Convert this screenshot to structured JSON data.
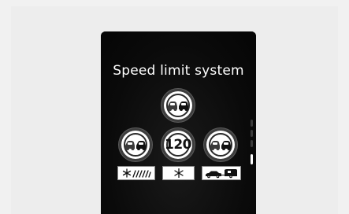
{
  "screen": {
    "title": "Speed limit system"
  },
  "signs": {
    "top": {
      "icon": "no-overtaking-icon"
    },
    "left": {
      "icon": "no-overtaking-icon"
    },
    "center": {
      "speed": "120"
    },
    "right": {
      "icon": "no-overtaking-icon"
    }
  },
  "conditions": {
    "left": {
      "icon": "snow-rain-icon"
    },
    "center": {
      "icon": "snowflake-icon"
    },
    "right": {
      "icon": "car-trailer-icon"
    }
  },
  "colors": {
    "screen_bg": "#0b0b0b",
    "sign_red_replacement": "#ffffff",
    "text": "#ffffff"
  }
}
